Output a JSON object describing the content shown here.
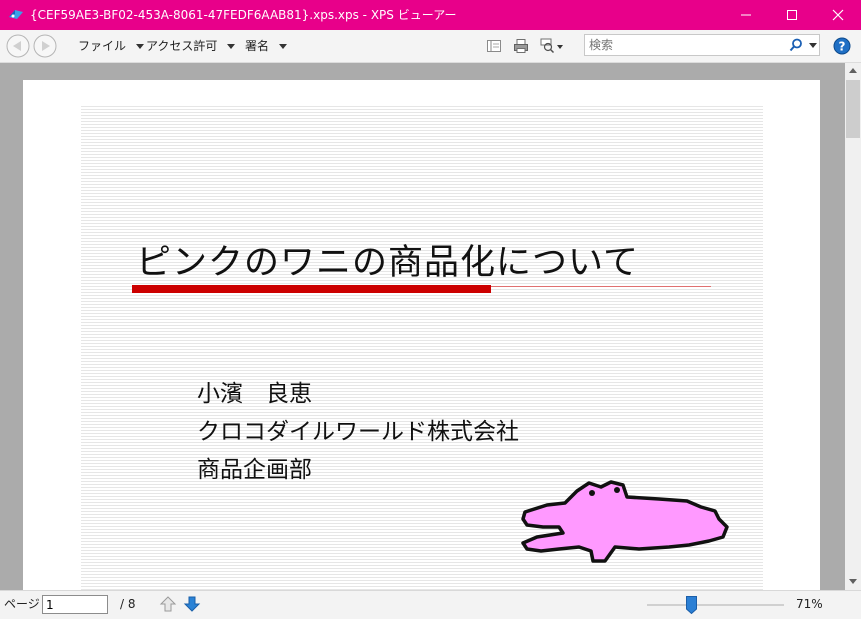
{
  "window": {
    "title": "{CEF59AE3-BF02-453A-8061-47FEDF6AAB81}.xps.xps - XPS ビューアー",
    "accent_color": "#e8008a"
  },
  "toolbar": {
    "menus": [
      {
        "label": "ファイル"
      },
      {
        "label": "アクセス許可"
      },
      {
        "label": "署名"
      }
    ],
    "search": {
      "placeholder": "検索",
      "value": ""
    }
  },
  "slide": {
    "title": "ピンクのワニの商品化について",
    "lines": [
      "小濱　良恵",
      "クロコダイルワールド株式会社",
      "商品企画部"
    ],
    "accent_color": "#cc0000",
    "croc_color": "#ff99ff"
  },
  "statusbar": {
    "page_label": "ページ",
    "current_page": "1",
    "total_pages": "/ 8",
    "zoom": "71%"
  }
}
